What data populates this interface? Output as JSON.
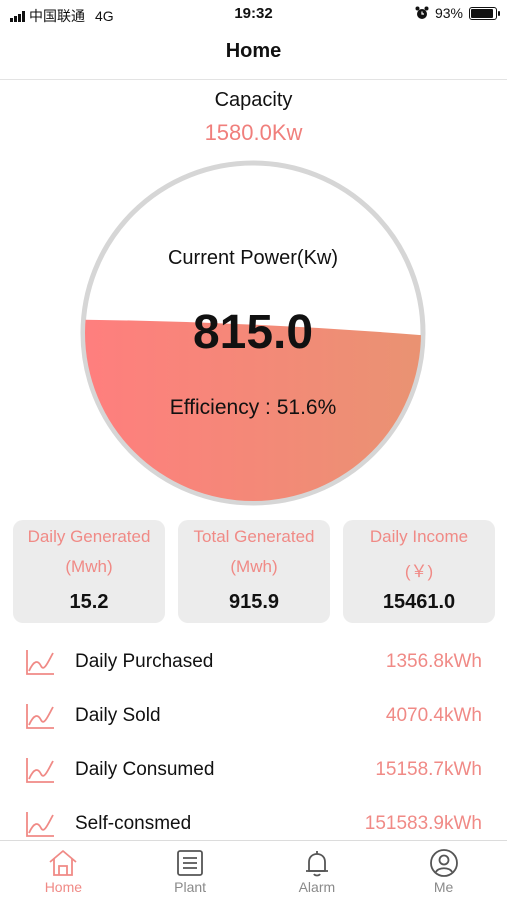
{
  "status_bar": {
    "carrier": "中国联通",
    "network": "4G",
    "time": "19:32",
    "battery": "93%",
    "battery_level": 0.93
  },
  "nav": {
    "title": "Home"
  },
  "capacity": {
    "label": "Capacity",
    "value": "1580.0Kw"
  },
  "gauge": {
    "label": "Current Power(Kw)",
    "value": "815.0",
    "efficiency": "Efficiency : 51.6%",
    "fill_fraction": 0.516,
    "colors": {
      "fill_start": "#ff7e7e",
      "fill_end": "#e99372",
      "ring": "#d6d6d6"
    }
  },
  "cards": [
    {
      "title": "Daily Generated",
      "unit": "(Mwh)",
      "value": "15.2"
    },
    {
      "title": "Total Generated",
      "unit": "(Mwh)",
      "value": "915.9"
    },
    {
      "title": "Daily Income",
      "unit": "(￥)",
      "value": "15461.0"
    }
  ],
  "list": [
    {
      "label": "Daily Purchased",
      "value": "1356.8kWh",
      "icon": "line-chart-icon"
    },
    {
      "label": "Daily Sold",
      "value": "4070.4kWh",
      "icon": "line-chart-icon"
    },
    {
      "label": "Daily Consumed",
      "value": "15158.7kWh",
      "icon": "line-chart-icon"
    },
    {
      "label": "Self-consmed",
      "value": "151583.9kWh",
      "icon": "line-chart-icon"
    }
  ],
  "tabs": [
    {
      "label": "Home",
      "icon": "home-icon",
      "active": true
    },
    {
      "label": "Plant",
      "icon": "list-icon",
      "active": false
    },
    {
      "label": "Alarm",
      "icon": "bell-icon",
      "active": false
    },
    {
      "label": "Me",
      "icon": "user-icon",
      "active": false
    }
  ],
  "colors": {
    "accent": "#f08a86",
    "card_bg": "#ececec",
    "inactive_tab": "#8a8a8a"
  }
}
